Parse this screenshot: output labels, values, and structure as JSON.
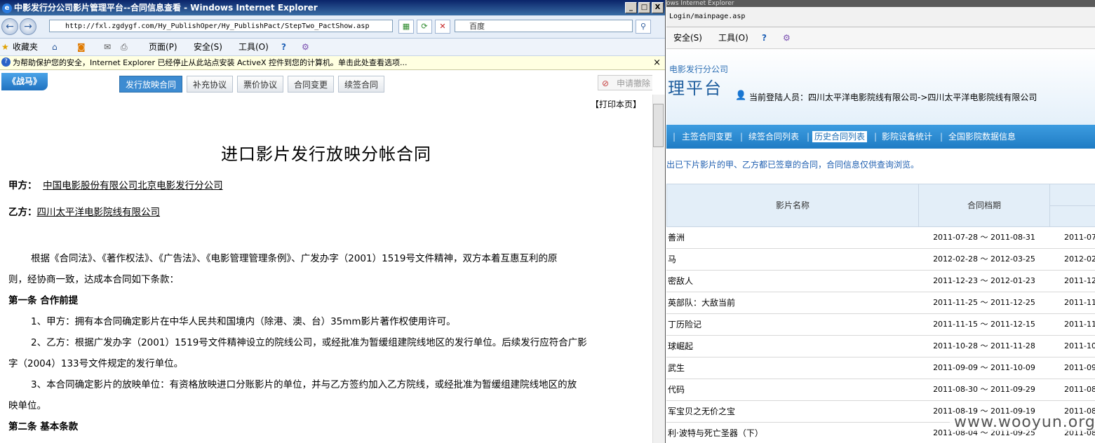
{
  "left_window": {
    "title": "中影发行分公司影片管理平台--合同信息查看 - Windows Internet Explorer",
    "min_label": "_",
    "max_label": "□",
    "close_label": "X",
    "address": "http://fxl.zgdygf.com/Hy_PublishOper/Hy_PublishPact/StepTwo_PactShow.asp",
    "search_placeholder": "百度",
    "favorites_label": "收藏夹",
    "commands": {
      "page": "页面(P)",
      "safety": "安全(S)",
      "tools": "工具(O)"
    },
    "infobar_text": "为帮助保护您的安全，Internet Explorer 已经停止从此站点安装 ActiveX 控件到您的计算机。单击此处查看选项...",
    "infobar_close": "×",
    "film_badge": "《战马》",
    "tabs": [
      "发行放映合同",
      "补充协议",
      "票价协议",
      "合同变更",
      "续签合同"
    ],
    "cancel_button": "申请撤除",
    "print_link": "【打印本页】",
    "doc": {
      "title": "进口影片发行放映分帐合同",
      "party_a_label": "甲方：",
      "party_a": "中国电影股份有限公司北京电影发行分公司",
      "party_b_label": "乙方：",
      "party_b": "四川太平洋电影院线有限公司",
      "intro_1": "根据《合同法》、《著作权法》、《广告法》、《电影管理管理条例》、广发办字（2001）1519号文件精神，双方本着互惠互利的原",
      "intro_2": "则，经协商一致，达成本合同如下条款：",
      "article1_title": "第一条  合作前提",
      "a1_item1": "1、甲方：拥有本合同确定影片在中华人民共和国境内（除港、澳、台）35mm影片著作权使用许可。",
      "a1_item2_1": "2、乙方：根据广发办字（2001）1519号文件精神设立的院线公司，或经批准为暂缓组建院线地区的发行单位。后续发行应符合广影",
      "a1_item2_2": "字（2004）133号文件规定的发行单位。",
      "a1_item3_1": "3、本合同确定影片的放映单位：有资格放映进口分账影片的单位，并与乙方签约加入乙方院线，或经批准为暂缓组建院线地区的放",
      "a1_item3_2": "映单位。",
      "article2_title": "第二条  基本条款"
    }
  },
  "right_window": {
    "title_fragment": "ows Internet Explorer",
    "address_fragment": "Login/mainpage.asp",
    "commands": {
      "safety": "安全(S)",
      "tools": "工具(O)"
    },
    "portal_subtitle": "电影发行分公司",
    "portal_title": "理平台",
    "current_user_label": "当前登陆人员：四川太平洋电影院线有限公司->四川太平洋电影院线有限公司",
    "nav": [
      "主签合同变更",
      "续签合同列表",
      "历史合同列表",
      "影院设备统计",
      "全国影院数据信息"
    ],
    "nav_separator": "|",
    "notice": "出已下片影片的甲、乙方都已签章的合同，合同信息仅供查询浏览。",
    "table": {
      "headers": [
        "影片名称",
        "合同档期"
      ],
      "rows": [
        {
          "film": "善洲",
          "period": "2011-07-28 ～ 2011-08-31",
          "next": "2011-07"
        },
        {
          "film": "马",
          "period": "2012-02-28 ～ 2012-03-25",
          "next": "2012-02"
        },
        {
          "film": "密敌人",
          "period": "2011-12-23 ～ 2012-01-23",
          "next": "2011-12"
        },
        {
          "film": "英部队：大敌当前",
          "period": "2011-11-25 ～ 2011-12-25",
          "next": "2011-11"
        },
        {
          "film": "丁历险记",
          "period": "2011-11-15 ～ 2011-12-15",
          "next": "2011-11"
        },
        {
          "film": "球崛起",
          "period": "2011-10-28 ～ 2011-11-28",
          "next": "2011-10"
        },
        {
          "film": "武生",
          "period": "2011-09-09 ～ 2011-10-09",
          "next": "2011-09"
        },
        {
          "film": "代码",
          "period": "2011-08-30 ～ 2011-09-29",
          "next": "2011-08"
        },
        {
          "film": "军宝贝之无价之宝",
          "period": "2011-08-19 ～ 2011-09-19",
          "next": "2011-08"
        },
        {
          "film": "利·波特与死亡圣器（下）",
          "period": "2011-08-04 ～ 2011-09-25",
          "next": "2011-08"
        }
      ]
    }
  },
  "watermark": "www.wooyun.org"
}
